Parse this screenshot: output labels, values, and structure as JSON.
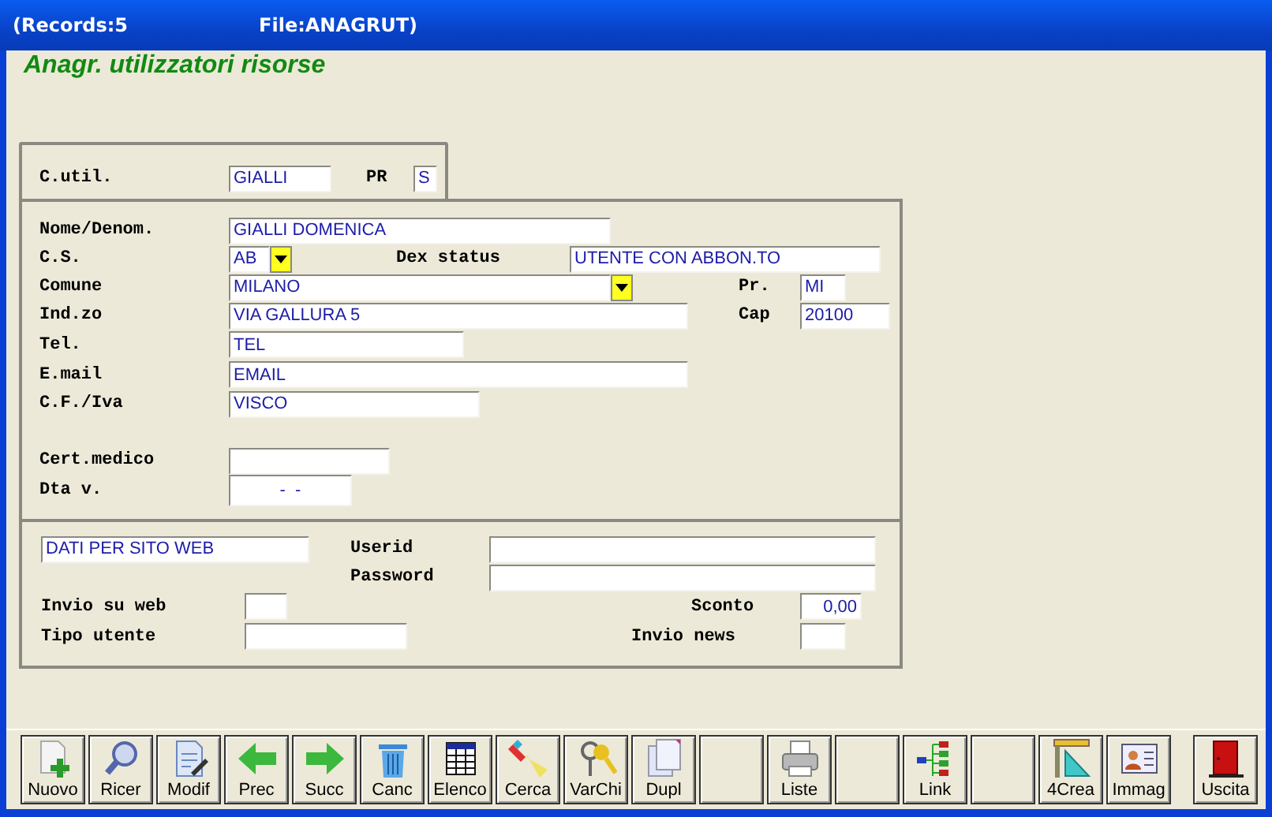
{
  "title_bar": {
    "records": "(Records:5",
    "file": "File:ANAGRUT)"
  },
  "heading": "Anagr. utilizzatori risorse",
  "key": {
    "c_util": {
      "label": "C.util.",
      "value": "GIALLI"
    },
    "pr": {
      "label": "PR",
      "value": "S"
    }
  },
  "details": {
    "nome": {
      "label": "Nome/Denom.",
      "value": "GIALLI DOMENICA"
    },
    "cs": {
      "label": "C.S.",
      "value": "AB",
      "dropdown": true
    },
    "dex_status": {
      "label": "Dex status",
      "value": "UTENTE CON ABBON.TO"
    },
    "comune": {
      "label": "Comune",
      "value": "MILANO",
      "dropdown": true
    },
    "pr": {
      "label": "Pr.",
      "value": "MI"
    },
    "indirizzo": {
      "label": "Ind.zo",
      "value": "VIA GALLURA 5"
    },
    "cap": {
      "label": "Cap",
      "value": "20100"
    },
    "tel": {
      "label": "Tel.",
      "value": "TEL"
    },
    "email": {
      "label": "E.mail",
      "value": "EMAIL"
    },
    "cf": {
      "label": "C.F./Iva",
      "value": "VISCO"
    },
    "cert": {
      "label": "Cert.medico"
    },
    "dta": {
      "label": "Dta v.",
      "value": "-  -"
    }
  },
  "web": {
    "section": {
      "value": "DATI PER SITO WEB"
    },
    "userid": {
      "label": "Userid"
    },
    "password": {
      "label": "Password"
    },
    "invio_web": {
      "label": "Invio su web"
    },
    "sconto": {
      "label": "Sconto",
      "value": "0,00"
    },
    "tipo": {
      "label": "Tipo utente"
    },
    "invio_news": {
      "label": "Invio news"
    }
  },
  "toolbar": [
    {
      "kind": "new",
      "label": "Nuovo"
    },
    {
      "kind": "search",
      "label": "Ricer"
    },
    {
      "kind": "edit",
      "label": "Modif"
    },
    {
      "kind": "prev",
      "label": "Prec"
    },
    {
      "kind": "next",
      "label": "Succ"
    },
    {
      "kind": "delete",
      "label": "Canc"
    },
    {
      "kind": "list",
      "label": "Elenco"
    },
    {
      "kind": "find",
      "label": "Cerca"
    },
    {
      "kind": "keys",
      "label": "VarChi"
    },
    {
      "kind": "copy",
      "label": "Dupl"
    },
    {
      "kind": "blank"
    },
    {
      "kind": "print",
      "label": "Liste"
    },
    {
      "kind": "blank"
    },
    {
      "kind": "link",
      "label": "Link"
    },
    {
      "kind": "blank"
    },
    {
      "kind": "create",
      "label": "4Crea"
    },
    {
      "kind": "image",
      "label": "Immag"
    },
    {
      "kind": "exit",
      "label": "Uscita"
    }
  ]
}
